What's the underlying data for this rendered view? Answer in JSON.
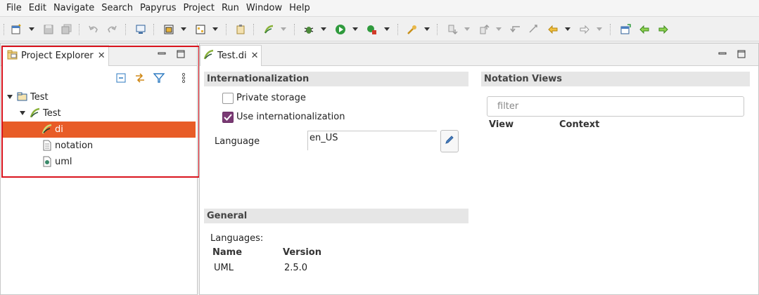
{
  "menu": [
    "File",
    "Edit",
    "Navigate",
    "Search",
    "Papyrus",
    "Project",
    "Run",
    "Window",
    "Help"
  ],
  "explorer": {
    "tab_title": "Project Explorer",
    "close_glyph": "✕",
    "tree": [
      {
        "label": "Test",
        "level": 0,
        "expanded": true,
        "icon": "project-folder-icon"
      },
      {
        "label": "Test",
        "level": 1,
        "expanded": true,
        "icon": "papyrus-model-icon"
      },
      {
        "label": "di",
        "level": 2,
        "selected": true,
        "icon": "papyrus-di-icon"
      },
      {
        "label": "notation",
        "level": 2,
        "icon": "notation-file-icon"
      },
      {
        "label": "uml",
        "level": 2,
        "icon": "uml-file-icon"
      }
    ]
  },
  "editor": {
    "tab_title": "Test.di",
    "close_glyph": "✕",
    "internationalization": {
      "heading": "Internationalization",
      "private_storage_label": "Private storage",
      "private_storage_checked": false,
      "use_i18n_label": "Use internationalization",
      "use_i18n_checked": true,
      "language_label": "Language",
      "language_value": "en_US"
    },
    "general": {
      "heading": "General",
      "languages_label": "Languages:",
      "columns": [
        "Name",
        "Version"
      ],
      "rows": [
        [
          "UML",
          "2.5.0"
        ]
      ]
    },
    "notation_views": {
      "heading": "Notation Views",
      "filter_placeholder": "filter",
      "columns": [
        "View",
        "Context"
      ]
    }
  },
  "colors": {
    "selection": "#e85c27",
    "highlight_outline": "#d9141e",
    "checkbox_checked": "#7a3a74"
  }
}
